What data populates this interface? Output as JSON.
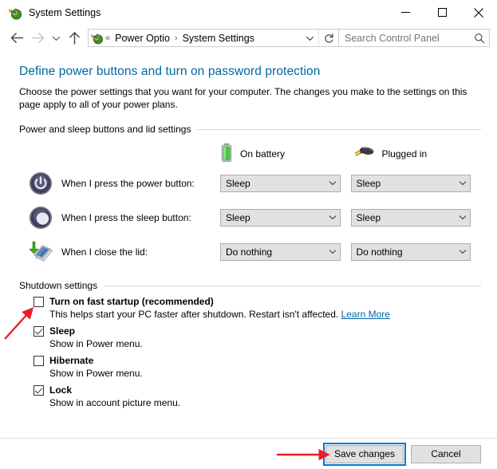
{
  "window": {
    "title": "System Settings",
    "icon": "power-options-icon",
    "controls": {
      "minimize": "minimize-icon",
      "maximize": "maximize-icon",
      "close": "close-icon"
    }
  },
  "navbar": {
    "back": "back-arrow-icon",
    "forward": "forward-arrow-icon",
    "recent": "chevron-down-icon",
    "up": "up-arrow-icon",
    "address": {
      "icon": "power-options-icon",
      "overflow": "«",
      "crumbs": [
        "Power Optio",
        "System Settings"
      ],
      "separator": "›",
      "dropdown": "chevron-down-icon",
      "refresh": "refresh-icon"
    },
    "search": {
      "placeholder": "Search Control Panel",
      "value": "",
      "icon": "search-icon"
    }
  },
  "page": {
    "heading": "Define power buttons and turn on password protection",
    "description": "Choose the power settings that you want for your computer. The changes you make to the settings on this page apply to all of your power plans."
  },
  "power_group": {
    "title": "Power and sleep buttons and lid settings",
    "columns": [
      {
        "label": "On battery",
        "icon": "battery-icon"
      },
      {
        "label": "Plugged in",
        "icon": "power-plug-icon"
      }
    ],
    "rows": [
      {
        "icon": "power-button-icon",
        "label": "When I press the power button:",
        "on_battery": "Sleep",
        "plugged_in": "Sleep"
      },
      {
        "icon": "sleep-button-icon",
        "label": "When I press the sleep button:",
        "on_battery": "Sleep",
        "plugged_in": "Sleep"
      },
      {
        "icon": "close-lid-icon",
        "label": "When I close the lid:",
        "on_battery": "Do nothing",
        "plugged_in": "Do nothing"
      }
    ]
  },
  "shutdown_group": {
    "title": "Shutdown settings",
    "options": [
      {
        "label": "Turn on fast startup (recommended)",
        "checked": false,
        "sub": "This helps start your PC faster after shutdown. Restart isn't affected.",
        "link": "Learn More"
      },
      {
        "label": "Sleep",
        "checked": true,
        "sub": "Show in Power menu.",
        "link": ""
      },
      {
        "label": "Hibernate",
        "checked": false,
        "sub": "Show in Power menu.",
        "link": ""
      },
      {
        "label": "Lock",
        "checked": true,
        "sub": "Show in account picture menu.",
        "link": ""
      }
    ]
  },
  "footer": {
    "save_label": "Save changes",
    "cancel_label": "Cancel",
    "save_focused": true
  },
  "annotations": {
    "color": "#ee1c25",
    "arrows": [
      {
        "name": "arrow-to-fast-startup-checkbox"
      },
      {
        "name": "arrow-to-save-changes-button"
      }
    ],
    "highlight": {
      "name": "save-changes-highlight",
      "color": "#0078d7"
    }
  }
}
